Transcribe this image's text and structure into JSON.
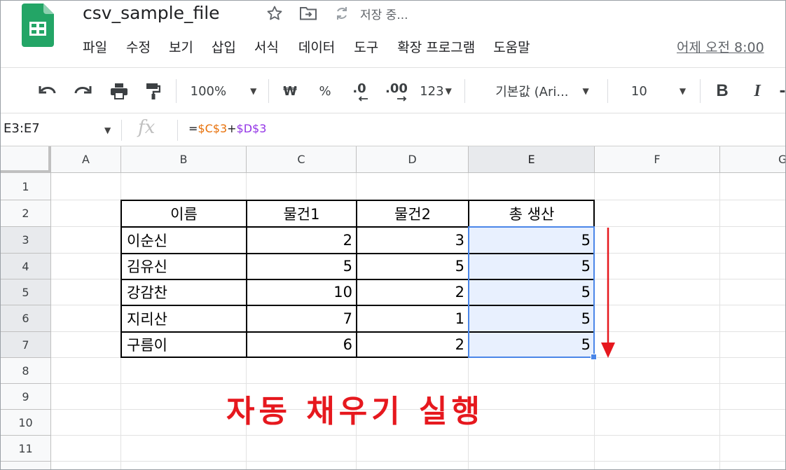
{
  "app": {
    "doc_title": "csv_sample_file",
    "save_status": "저장 중...",
    "last_edit": "어제 오전 8:00",
    "brand_color": "#0f9d58"
  },
  "menu": [
    "파일",
    "수정",
    "보기",
    "삽입",
    "서식",
    "데이터",
    "도구",
    "확장 프로그램",
    "도움말"
  ],
  "toolbar": {
    "zoom": "100%",
    "currency": "₩",
    "percent": "%",
    "dec_decrease": ".0",
    "dec_increase": ".00",
    "more_formats": "123",
    "font": "기본값 (Ari...",
    "font_size": "10",
    "bold": "B",
    "italic": "I"
  },
  "formula_bar": {
    "name_box": "E3:E7",
    "fx": "fx",
    "formula_eq": "=",
    "formula_ref1": "$C$3",
    "formula_op": "+",
    "formula_ref2": "$D$3"
  },
  "columns": [
    "A",
    "B",
    "C",
    "D",
    "E",
    "F",
    "G"
  ],
  "rows": [
    "1",
    "2",
    "3",
    "4",
    "5",
    "6",
    "7",
    "8",
    "9",
    "10",
    "11"
  ],
  "table": {
    "headers": [
      "이름",
      "물건1",
      "물건2",
      "총 생산"
    ],
    "rows": [
      {
        "name": "이순신",
        "item1": "2",
        "item2": "3",
        "total": "5"
      },
      {
        "name": "김유신",
        "item1": "5",
        "item2": "5",
        "total": "5"
      },
      {
        "name": "강감찬",
        "item1": "10",
        "item2": "2",
        "total": "5"
      },
      {
        "name": "지리산",
        "item1": "7",
        "item2": "1",
        "total": "5"
      },
      {
        "name": "구름이",
        "item1": "6",
        "item2": "2",
        "total": "5"
      }
    ]
  },
  "annotation": {
    "text": "자동 채우기 실행",
    "color": "#e6181e"
  },
  "colors": {
    "selection": "#4a86e8",
    "selection_fill": "#e8f0fe"
  }
}
